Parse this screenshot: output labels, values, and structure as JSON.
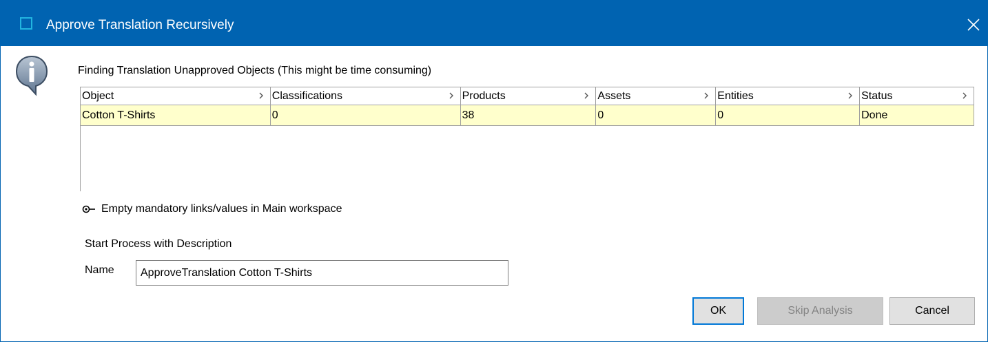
{
  "window": {
    "title": "Approve Translation Recursively",
    "accent_color": "#0063b1"
  },
  "heading": "Finding Translation Unapproved Objects (This might be time consuming)",
  "table": {
    "columns": [
      "Object",
      "Classifications",
      "Products",
      "Assets",
      "Entities",
      "Status"
    ],
    "rows": [
      [
        "Cotton T-Shirts",
        "0",
        "38",
        "0",
        "0",
        "Done"
      ]
    ],
    "row_highlight_color": "#ffffcc"
  },
  "mandatory_link": "Empty mandatory links/values in Main workspace",
  "process": {
    "section_label": "Start Process with Description",
    "name_label": "Name",
    "name_value": "ApproveTranslation Cotton T-Shirts"
  },
  "buttons": {
    "ok": "OK",
    "skip": "Skip Analysis",
    "cancel": "Cancel"
  },
  "icons": {
    "title": "window-icon",
    "close": "close-icon",
    "info": "info-bubble-icon",
    "link": "key-icon",
    "column_menu": "chevron-right-icon"
  }
}
